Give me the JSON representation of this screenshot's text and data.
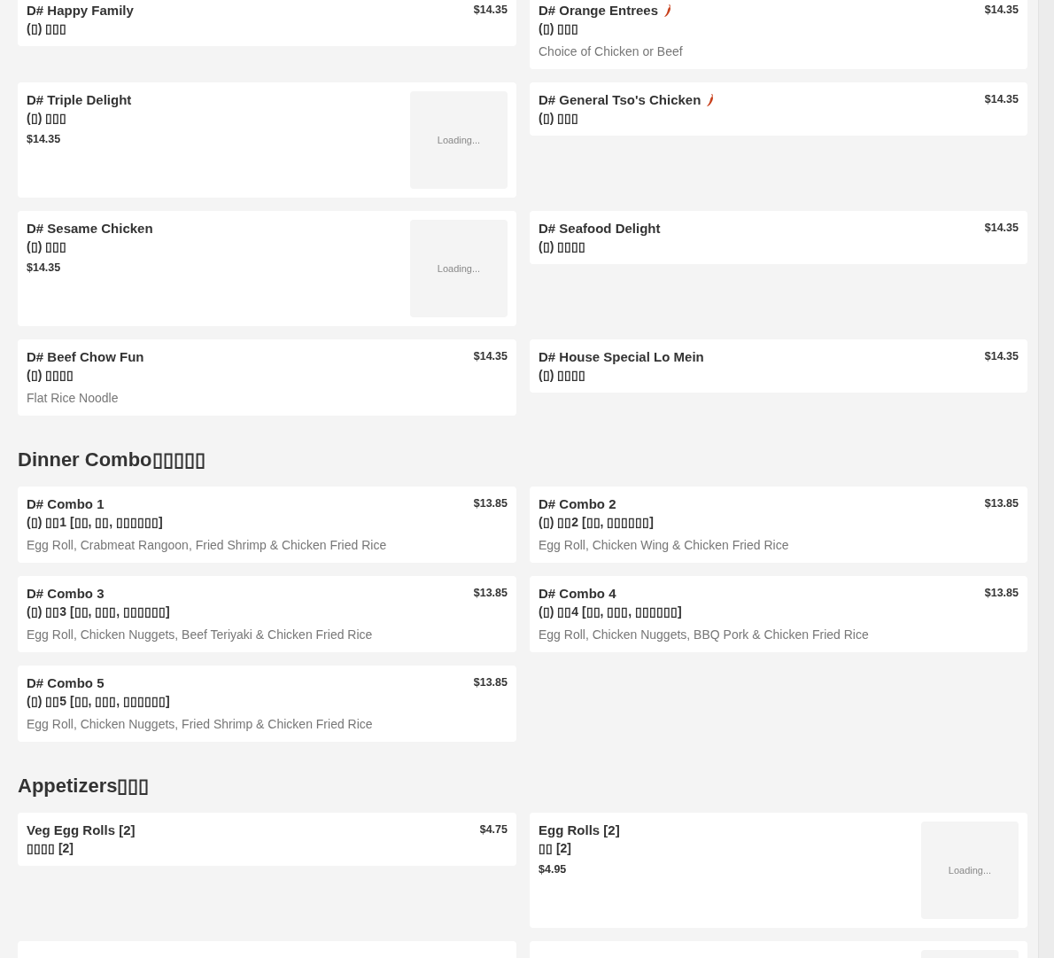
{
  "sections": [
    {
      "items": [
        {
          "kind": "item",
          "name": "D# Happy Family",
          "chinese": "(▯) ▯▯▯",
          "price": "$14.35",
          "spicy": false
        },
        {
          "kind": "item",
          "name": "D# Orange Entrees",
          "chinese": "(▯) ▯▯▯",
          "description": "Choice of Chicken or Beef",
          "price": "$14.35",
          "spicy": true
        },
        {
          "kind": "item",
          "name": "D# Triple Delight",
          "chinese": "(▯) ▯▯▯",
          "price": "$14.35",
          "spicy": false,
          "image_status": "Loading..."
        },
        {
          "kind": "item",
          "name": "D# General Tso's Chicken",
          "chinese": "(▯) ▯▯▯",
          "price": "$14.35",
          "spicy": true
        },
        {
          "kind": "item",
          "name": "D# Sesame Chicken",
          "chinese": "(▯) ▯▯▯",
          "price": "$14.35",
          "spicy": false,
          "image_status": "Loading..."
        },
        {
          "kind": "item",
          "name": "D# Seafood Delight",
          "chinese": "(▯) ▯▯▯▯",
          "price": "$14.35",
          "spicy": false
        },
        {
          "kind": "item",
          "name": "D# Beef Chow Fun",
          "chinese": "(▯) ▯▯▯▯",
          "description": "Flat Rice Noodle",
          "price": "$14.35",
          "spicy": false
        },
        {
          "kind": "item",
          "name": "D# House Special Lo Mein",
          "chinese": "(▯) ▯▯▯▯",
          "price": "$14.35",
          "spicy": false
        }
      ]
    },
    {
      "title": "Dinner Combo▯▯▯▯▯",
      "items": [
        {
          "kind": "item",
          "name": "D# Combo 1",
          "chinese": "(▯) ▯▯1 [▯▯, ▯▯, ▯▯▯▯▯▯]",
          "description": "Egg Roll, Crabmeat Rangoon, Fried Shrimp & Chicken Fried Rice",
          "price": "$13.85",
          "spicy": false
        },
        {
          "kind": "item",
          "name": "D# Combo 2",
          "chinese": "(▯) ▯▯2 [▯▯, ▯▯▯▯▯▯]",
          "description": "Egg Roll, Chicken Wing & Chicken Fried Rice",
          "price": "$13.85",
          "spicy": false
        },
        {
          "kind": "item",
          "name": "D# Combo 3",
          "chinese": "(▯) ▯▯3 [▯▯, ▯▯▯, ▯▯▯▯▯▯]",
          "description": "Egg Roll, Chicken Nuggets, Beef Teriyaki & Chicken Fried Rice",
          "price": "$13.85",
          "spicy": false
        },
        {
          "kind": "item",
          "name": "D# Combo 4",
          "chinese": "(▯) ▯▯4 [▯▯, ▯▯▯, ▯▯▯▯▯▯]",
          "description": "Egg Roll, Chicken Nuggets, BBQ Pork & Chicken Fried Rice",
          "price": "$13.85",
          "spicy": false
        },
        {
          "kind": "item",
          "name": "D# Combo 5",
          "chinese": "(▯) ▯▯5 [▯▯, ▯▯▯, ▯▯▯▯▯▯]",
          "description": "Egg Roll, Chicken Nuggets, Fried Shrimp & Chicken Fried Rice",
          "price": "$13.85",
          "spicy": false
        }
      ]
    },
    {
      "title": "Appetizers▯▯▯",
      "items": [
        {
          "kind": "item",
          "name": "Veg Egg Rolls [2]",
          "chinese": "▯▯▯▯ [2]",
          "price": "$4.75",
          "spicy": false
        },
        {
          "kind": "item",
          "name": "Egg Rolls [2]",
          "chinese": "▯▯ [2]",
          "price": "$4.95",
          "spicy": false,
          "image_status": "Loading..."
        },
        {
          "kind": "clipped",
          "has_image": false
        },
        {
          "kind": "clipped",
          "has_image": true
        }
      ]
    }
  ]
}
